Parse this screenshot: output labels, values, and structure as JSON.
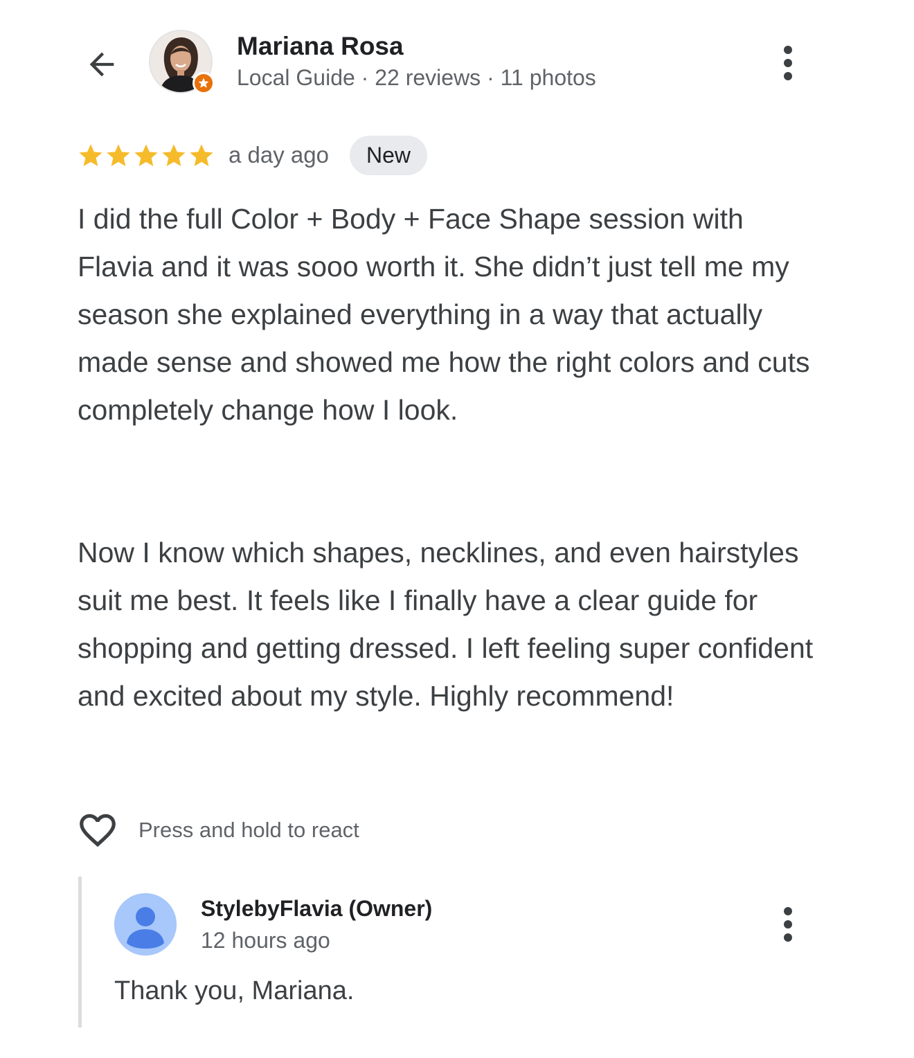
{
  "header": {
    "back_icon": "arrow-back-icon",
    "reviewer_name": "Mariana Rosa",
    "reviewer_meta": "Local Guide · 22 reviews · 11 photos",
    "badge_icon": "local-guide-star-icon",
    "more_icon": "more-vertical-icon"
  },
  "review": {
    "rating": 5,
    "rating_max": 5,
    "star_color": "#f6bb2b",
    "time_ago": "a day ago",
    "badge": "New",
    "paragraph_1": "I did the full Color + Body + Face Shape session with Flavia and it was sooo worth it. She didn’t just tell me my season she explained everything in a way that actually made sense and showed me how the right colors and cuts completely change how I look.",
    "paragraph_2": "Now I know which shapes, necklines, and even hairstyles suit me best. It feels like I finally have a clear guide for shopping and getting dressed. I left feeling super confident and excited about my style. Highly recommend!"
  },
  "react": {
    "icon": "heart-outline-icon",
    "label": "Press and hold to react"
  },
  "owner_reply": {
    "avatar_icon": "person-icon",
    "avatar_color": "#a8c7fa",
    "name": "StylebyFlavia (Owner)",
    "time": "12 hours ago",
    "text": "Thank you, Mariana.",
    "more_icon": "more-vertical-icon"
  }
}
